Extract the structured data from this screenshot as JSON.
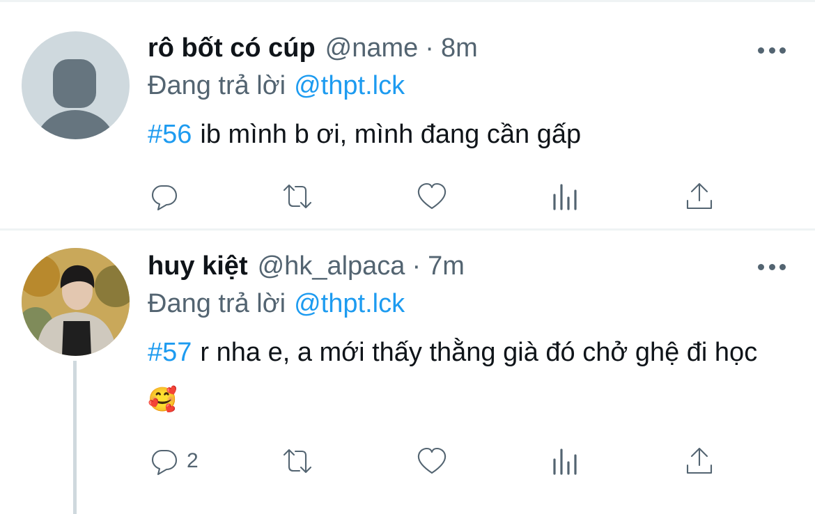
{
  "tweets": [
    {
      "display_name": "rô bốt có cúp",
      "handle": "@name",
      "separator": "·",
      "time": "8m",
      "reply_prefix": "Đang trả lời",
      "reply_to": "@thpt.lck",
      "hashtag": "#56",
      "text": "ib mình b ơi, mình đang cần gấp",
      "emoji": "",
      "reply_count": "",
      "avatar": "default-avatar"
    },
    {
      "display_name": "huy kiệt",
      "handle": "@hk_alpaca",
      "separator": "·",
      "time": "7m",
      "reply_prefix": "Đang trả lời",
      "reply_to": "@thpt.lck",
      "hashtag": "#57",
      "text": "r nha e, a mới thấy thằng già đó chở ghệ đi học",
      "emoji": "🥰",
      "reply_count": "2",
      "avatar": "profile-photo"
    }
  ],
  "icons": [
    "reply-icon",
    "retweet-icon",
    "like-icon",
    "views-icon",
    "share-icon",
    "more-icon"
  ],
  "colors": {
    "accent": "#1d9bf0",
    "secondary_text": "#536471",
    "primary_text": "#0f1419",
    "divider": "#eff3f4"
  }
}
